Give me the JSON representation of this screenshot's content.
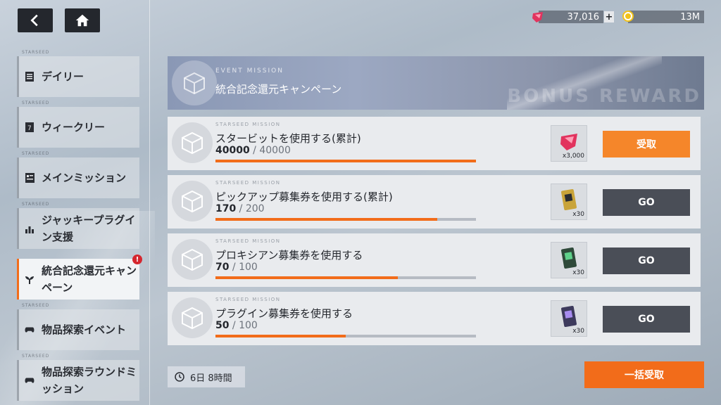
{
  "nav": {
    "back_icon": "back-arrow-icon",
    "home_icon": "home-icon"
  },
  "currencies": [
    {
      "icon": "star-bit-gem-icon",
      "value": "37,016",
      "plus": "+"
    },
    {
      "icon": "coin-icon",
      "value": "13M"
    }
  ],
  "sidebar": {
    "items": [
      {
        "tag": "STARSEED",
        "label": "デイリー",
        "icon": "daily-icon"
      },
      {
        "tag": "STARSEED",
        "label": "ウィークリー",
        "icon": "weekly-icon"
      },
      {
        "tag": "STARSEED",
        "label": "メインミッション",
        "icon": "main-mission-icon"
      },
      {
        "tag": "STARSEED",
        "label": "ジャッキープラグイン支援",
        "icon": "support-icon"
      },
      {
        "tag": "",
        "label": "統合記念還元キャンペーン",
        "icon": "sprout-icon",
        "alert": "!"
      },
      {
        "tag": "STARSEED",
        "label": "物品探索イベント",
        "icon": "gamepad-icon"
      },
      {
        "tag": "STARSEED",
        "label": "物品探索ラウンドミッション",
        "icon": "gamepad-icon"
      }
    ]
  },
  "banner": {
    "eyebrow": "EVENT MISSION",
    "title": "統合記念還元キャンペーン",
    "deco": "BONUS REWARD"
  },
  "missions": [
    {
      "eyebrow": "STARSEED MISSION",
      "title": "スタービットを使用する(累計)",
      "current": "40000",
      "total": " / 40000",
      "progress": 1.0,
      "reward_qty": "x3,000",
      "reward_icon": "star-bit-gem-icon",
      "button": "受取",
      "state": "claim"
    },
    {
      "eyebrow": "STARSEED MISSION",
      "title": "ピックアップ募集券を使用する(累計)",
      "current": "170",
      "total": " / 200",
      "progress": 0.85,
      "reward_qty": "x30",
      "reward_icon": "gold-ticket-icon",
      "button": "GO",
      "state": "go"
    },
    {
      "eyebrow": "STARSEED MISSION",
      "title": "プロキシアン募集券を使用する",
      "current": "70",
      "total": " / 100",
      "progress": 0.7,
      "reward_qty": "x30",
      "reward_icon": "green-ticket-icon",
      "button": "GO",
      "state": "go"
    },
    {
      "eyebrow": "STARSEED MISSION",
      "title": "プラグイン募集券を使用する",
      "current": "50",
      "total": " / 100",
      "progress": 0.5,
      "reward_qty": "x30",
      "reward_icon": "purple-ticket-icon",
      "button": "GO",
      "state": "go"
    }
  ],
  "timer": {
    "icon": "clock-icon",
    "text": "6日 8時間"
  },
  "claim_all": "一括受取",
  "colors": {
    "accent": "#f26c1a",
    "go_button": "#4a4e57",
    "claim_button": "#f5862a"
  }
}
